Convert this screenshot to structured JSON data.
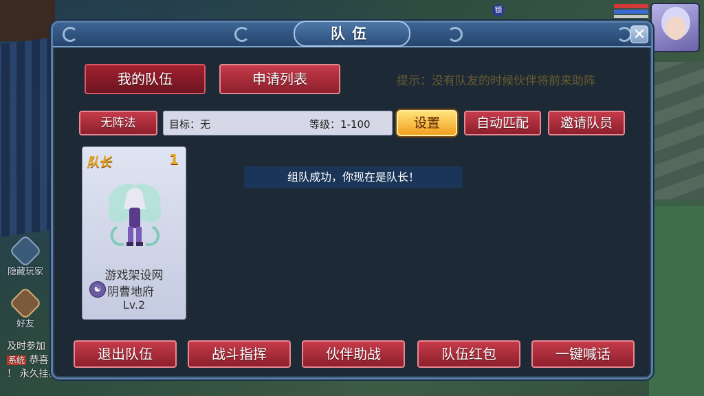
{
  "hud": {
    "badge_glyph": "锁",
    "side_buttons": [
      {
        "label": "隐藏玩家",
        "icon": "no-sign-icon"
      },
      {
        "label": "好友",
        "icon": "handshake-icon"
      }
    ],
    "chat_lines": [
      "及时参加",
      "恭喜",
      "！ 永久挂机"
    ],
    "chat_tag": "系统"
  },
  "dialog": {
    "title": "队伍",
    "close": "✕",
    "tabs": [
      {
        "label": "我的队伍",
        "active": true
      },
      {
        "label": "申请列表",
        "active": false
      }
    ],
    "hint": "提示：没有队友的时候伙伴将前来助阵",
    "formation_button": "无阵法",
    "target_label": "目标：无",
    "level_label": "等级：1-100",
    "settings_button": "设置",
    "auto_match_button": "自动匹配",
    "invite_button": "邀请队员",
    "status_message": "组队成功，你现在是队长！",
    "member": {
      "role": "队长",
      "slot": "1",
      "name": "游戏架设网",
      "sect": "阴曹地府",
      "level": "Lv.2"
    },
    "bottom_buttons": [
      "退出队伍",
      "战斗指挥",
      "伙伴助战",
      "队伍红包",
      "一键喊话"
    ]
  },
  "colors": {
    "panel_bg": "#1d2a35",
    "button_red": "#8e1f2c",
    "button_orange": "#f0a020",
    "header_blue": "#25446d"
  }
}
